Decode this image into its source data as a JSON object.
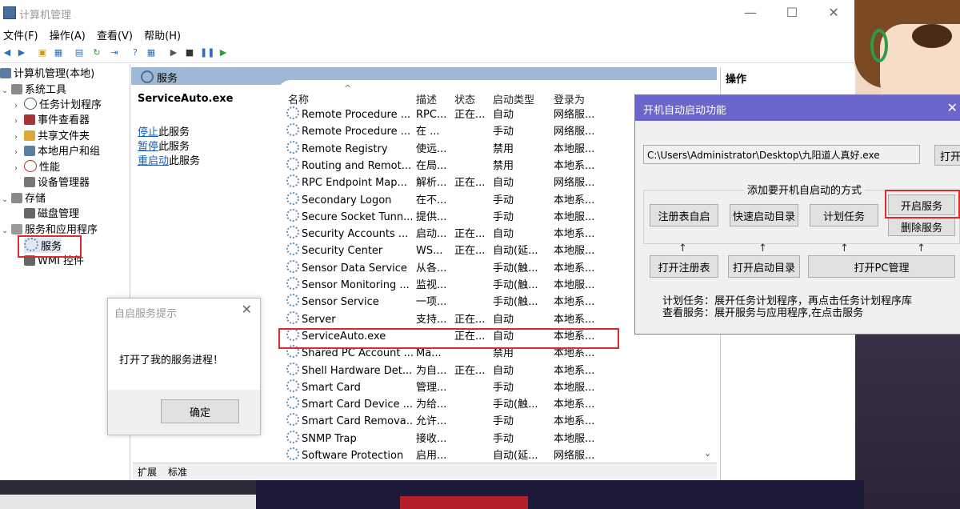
{
  "window": {
    "title": "计算机管理",
    "minimize": "—",
    "maximize": "☐",
    "close": "✕"
  },
  "menu": [
    "文件(F)",
    "操作(A)",
    "查看(V)",
    "帮助(H)"
  ],
  "tree": {
    "root": "计算机管理(本地)",
    "system_tools": "系统工具",
    "task_scheduler": "任务计划程序",
    "event_viewer": "事件查看器",
    "shared_folders": "共享文件夹",
    "local_users": "本地用户和组",
    "performance": "性能",
    "device_manager": "设备管理器",
    "storage": "存储",
    "disk_management": "磁盘管理",
    "services_apps": "服务和应用程序",
    "services": "服务",
    "wmi": "WMI 控件"
  },
  "services_header": "服务",
  "detail": {
    "name": "ServiceAuto.exe",
    "stop": "停止",
    "stop_rest": "此服务",
    "pause": "暂停",
    "pause_rest": "此服务",
    "restart": "重启动",
    "restart_rest": "此服务"
  },
  "columns": {
    "name": "名称",
    "desc": "描述",
    "status": "状态",
    "startup": "启动类型",
    "logon": "登录为"
  },
  "services": [
    {
      "name": "Remote Procedure ...",
      "desc": "RPC...",
      "status": "正在...",
      "startup": "自动",
      "logon": "网络服..."
    },
    {
      "name": "Remote Procedure ...",
      "desc": "在 ...",
      "status": "",
      "startup": "手动",
      "logon": "网络服..."
    },
    {
      "name": "Remote Registry",
      "desc": "使远...",
      "status": "",
      "startup": "禁用",
      "logon": "本地服..."
    },
    {
      "name": "Routing and Remot...",
      "desc": "在局...",
      "status": "",
      "startup": "禁用",
      "logon": "本地系..."
    },
    {
      "name": "RPC Endpoint Map...",
      "desc": "解析...",
      "status": "正在...",
      "startup": "自动",
      "logon": "网络服..."
    },
    {
      "name": "Secondary Logon",
      "desc": "在不...",
      "status": "",
      "startup": "手动",
      "logon": "本地系..."
    },
    {
      "name": "Secure Socket Tunn...",
      "desc": "提供...",
      "status": "",
      "startup": "手动",
      "logon": "本地服..."
    },
    {
      "name": "Security Accounts ...",
      "desc": "启动...",
      "status": "正在...",
      "startup": "自动",
      "logon": "本地系..."
    },
    {
      "name": "Security Center",
      "desc": "WS...",
      "status": "正在...",
      "startup": "自动(延...",
      "logon": "本地服..."
    },
    {
      "name": "Sensor Data Service",
      "desc": "从各...",
      "status": "",
      "startup": "手动(触...",
      "logon": "本地系..."
    },
    {
      "name": "Sensor Monitoring ...",
      "desc": "监视...",
      "status": "",
      "startup": "手动(触...",
      "logon": "本地服..."
    },
    {
      "name": "Sensor Service",
      "desc": "一项...",
      "status": "",
      "startup": "手动(触...",
      "logon": "本地系..."
    },
    {
      "name": "Server",
      "desc": "支持...",
      "status": "正在...",
      "startup": "自动",
      "logon": "本地系..."
    },
    {
      "name": "ServiceAuto.exe",
      "desc": "",
      "status": "正在...",
      "startup": "自动",
      "logon": "本地系..."
    },
    {
      "name": "Shared PC Account ...",
      "desc": "Ma...",
      "status": "",
      "startup": "禁用",
      "logon": "本地系..."
    },
    {
      "name": "Shell Hardware Det...",
      "desc": "为自...",
      "status": "正在...",
      "startup": "自动",
      "logon": "本地系..."
    },
    {
      "name": "Smart Card",
      "desc": "管理...",
      "status": "",
      "startup": "手动",
      "logon": "本地服..."
    },
    {
      "name": "Smart Card Device ...",
      "desc": "为给...",
      "status": "",
      "startup": "手动(触...",
      "logon": "本地系..."
    },
    {
      "name": "Smart Card Remova...",
      "desc": "允许...",
      "status": "",
      "startup": "手动",
      "logon": "本地系..."
    },
    {
      "name": "SNMP Trap",
      "desc": "接收...",
      "status": "",
      "startup": "手动",
      "logon": "本地服..."
    },
    {
      "name": "Software Protection",
      "desc": "启用...",
      "status": "",
      "startup": "自动(延...",
      "logon": "网络服..."
    }
  ],
  "tabs": {
    "extended": "扩展",
    "standard": "标准"
  },
  "actions_header": "操作",
  "msgbox": {
    "title": "自启服务提示",
    "close": "✕",
    "message": "打开了我的服务进程！",
    "ok": "确定"
  },
  "tool": {
    "title": "开机自动启动功能",
    "close": "✕",
    "path": "C:\\Users\\Administrator\\Desktop\\九阳道人真好.exe",
    "open": "打开",
    "group_label": "添加要开机自启动的方式",
    "btn_registry": "注册表自启",
    "btn_startup_dir": "快速启动目录",
    "btn_task": "计划任务",
    "btn_start_service": "开启服务",
    "btn_delete_service": "删除服务",
    "btn_open_registry": "打开注册表",
    "btn_open_startup": "打开启动目录",
    "btn_open_pc": "打开PC管理",
    "arrow": "↑",
    "info1": "计划任务：展开任务计划程序，再点击任务计划程序库",
    "info2": "查看服务：展开服务与应用程序,在点击服务"
  },
  "colors": {
    "highlight": "#e0292f",
    "tool_title": "#6a66cc",
    "header": "#9eb8d6"
  }
}
